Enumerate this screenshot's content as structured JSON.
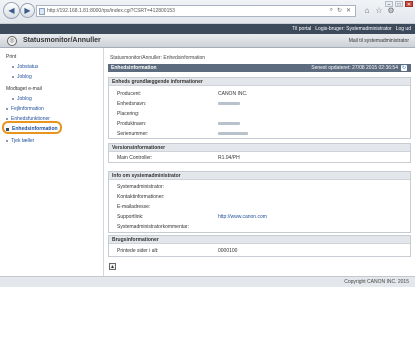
{
  "browser": {
    "url": "http://192.168.1.81:8000/rps/index.cgi?CSRT=412800153",
    "back_icon": "back-arrow-icon",
    "forward_icon": "forward-arrow-icon"
  },
  "topbar": {
    "portal_link": "Til portal",
    "login_user": "Logis-bruger: Systemadministrator",
    "logout_link": "Log ud"
  },
  "header": {
    "title": "Statusmonitor/Annuller",
    "mail": "Mail til systemadministrator"
  },
  "sidebar": {
    "items": [
      {
        "label": "Print",
        "type": "heading"
      },
      {
        "label": "Jobstatus",
        "type": "sub"
      },
      {
        "label": "Joblog",
        "type": "sub"
      },
      {
        "label": "Modtaget e-mail",
        "type": "heading"
      },
      {
        "label": "Joblog",
        "type": "sub"
      },
      {
        "label": "Fejlinformation",
        "type": "item"
      },
      {
        "label": "Enhedsfunktioner",
        "type": "item"
      },
      {
        "label": "Enhedsinformation",
        "type": "active"
      },
      {
        "label": "Tjek tæller",
        "type": "item"
      }
    ]
  },
  "main": {
    "breadcrumb": "Statusmonitor/Annuller: Enhedsinformation",
    "section_title": "Enhedsinformation",
    "last_updated_label": "Senest opdateret: 27/08 2015 02:36:54",
    "basic": {
      "title": "Enheds grundlæggende informationer",
      "rows": [
        {
          "label": "Producent:",
          "value": "CANON INC."
        },
        {
          "label": "Enhedsnavn:",
          "value": ""
        },
        {
          "label": "Placering:",
          "value": ""
        },
        {
          "label": "Produktnavn:",
          "value": ""
        },
        {
          "label": "Serienummer:",
          "value": ""
        }
      ]
    },
    "version": {
      "title": "Versionsinformationer",
      "rows": [
        {
          "label": "Main Controller:",
          "value": "R1.04/PH"
        }
      ]
    },
    "admin": {
      "title": "Info om systemadministrator",
      "rows": [
        {
          "label": "Systemadministrator:",
          "value": ""
        },
        {
          "label": "Kontaktinformationer:",
          "value": ""
        },
        {
          "label": "E-mailadresse:",
          "value": ""
        },
        {
          "label": "Supportlink:",
          "value": "http://www.canon.com"
        },
        {
          "label": "Systemadministratorkommentar:",
          "value": ""
        }
      ]
    },
    "usage": {
      "title": "Brugsinformationer",
      "rows": [
        {
          "label": "Printede sider i alt:",
          "value": "0000100"
        }
      ]
    }
  },
  "footer": {
    "copyright": "Copyright CANON INC. 2015"
  }
}
